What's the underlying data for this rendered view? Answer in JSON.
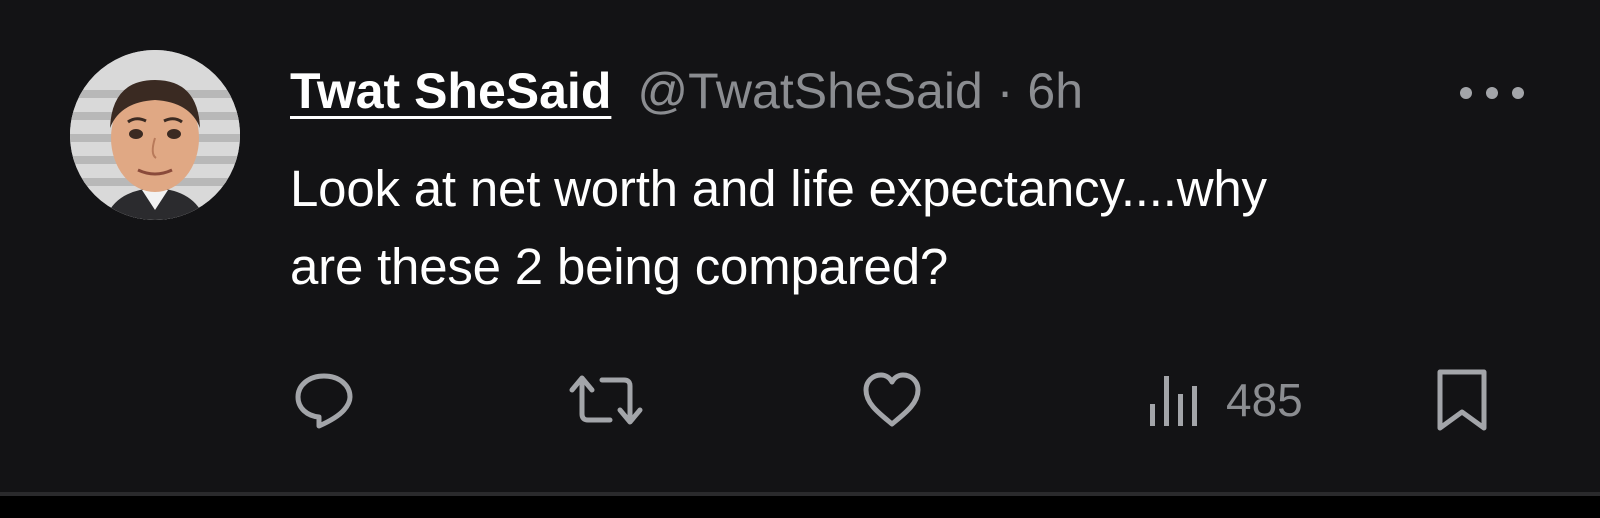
{
  "tweet": {
    "display_name": "Twat SheSaid",
    "handle": "@TwatSheSaid",
    "separator": "·",
    "time": "6h",
    "text_line1": "Look at net worth and life expectancy....why",
    "text_line2": "are these 2 being compared?"
  },
  "actions": {
    "reply_icon": "speech-bubble-icon",
    "retweet_icon": "retweet-icon",
    "like_icon": "heart-icon",
    "views_icon": "bar-chart-icon",
    "views_count": "485",
    "bookmark_icon": "bookmark-icon",
    "more_icon": "ellipsis-icon"
  },
  "colors": {
    "background": "#131315",
    "primary_text": "#ffffff",
    "secondary_text": "#8b8d91",
    "icon": "#a3a5a9"
  }
}
